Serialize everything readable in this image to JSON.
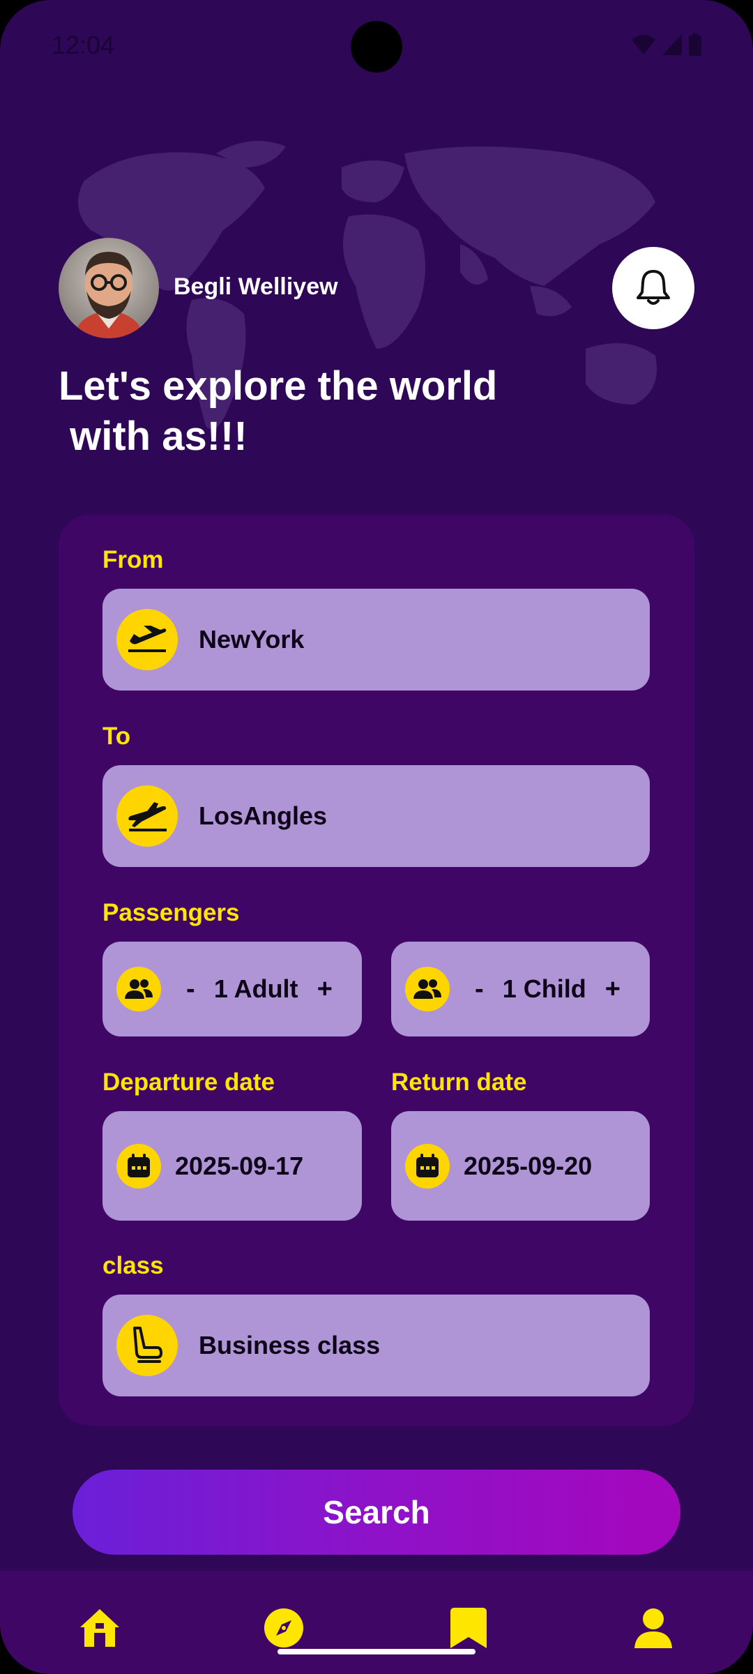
{
  "status_bar": {
    "time": "12:04"
  },
  "header": {
    "user_name": "Begli Welliyew",
    "headline": "Let's explore the world\n with as!!!"
  },
  "form": {
    "from": {
      "label": "From",
      "value": "NewYork",
      "icon": "plane-takeoff-icon"
    },
    "to": {
      "label": "To",
      "value": "LosAngles",
      "icon": "plane-landing-icon"
    },
    "passengers": {
      "label": "Passengers",
      "adult": {
        "minus": "-",
        "value": "1 Adult",
        "plus": "+"
      },
      "child": {
        "minus": "-",
        "value": "1 Child",
        "plus": "+"
      }
    },
    "departure": {
      "label": "Departure date",
      "value": "2025-09-17"
    },
    "return": {
      "label": "Return date",
      "value": "2025-09-20"
    },
    "class": {
      "label": "class",
      "value": "Business class",
      "icon": "seat-icon"
    }
  },
  "search_button": {
    "label": "Search"
  },
  "bottom_nav": {
    "items": [
      "home-icon",
      "compass-icon",
      "bookmark-icon",
      "profile-icon"
    ]
  },
  "colors": {
    "background": "#2e0757",
    "card": "#3f0666",
    "field": "#af94d6",
    "accent": "#ffe600",
    "icon_bg": "#ffd500",
    "button_gradient_start": "#6a20d8",
    "button_gradient_end": "#a507bd"
  }
}
